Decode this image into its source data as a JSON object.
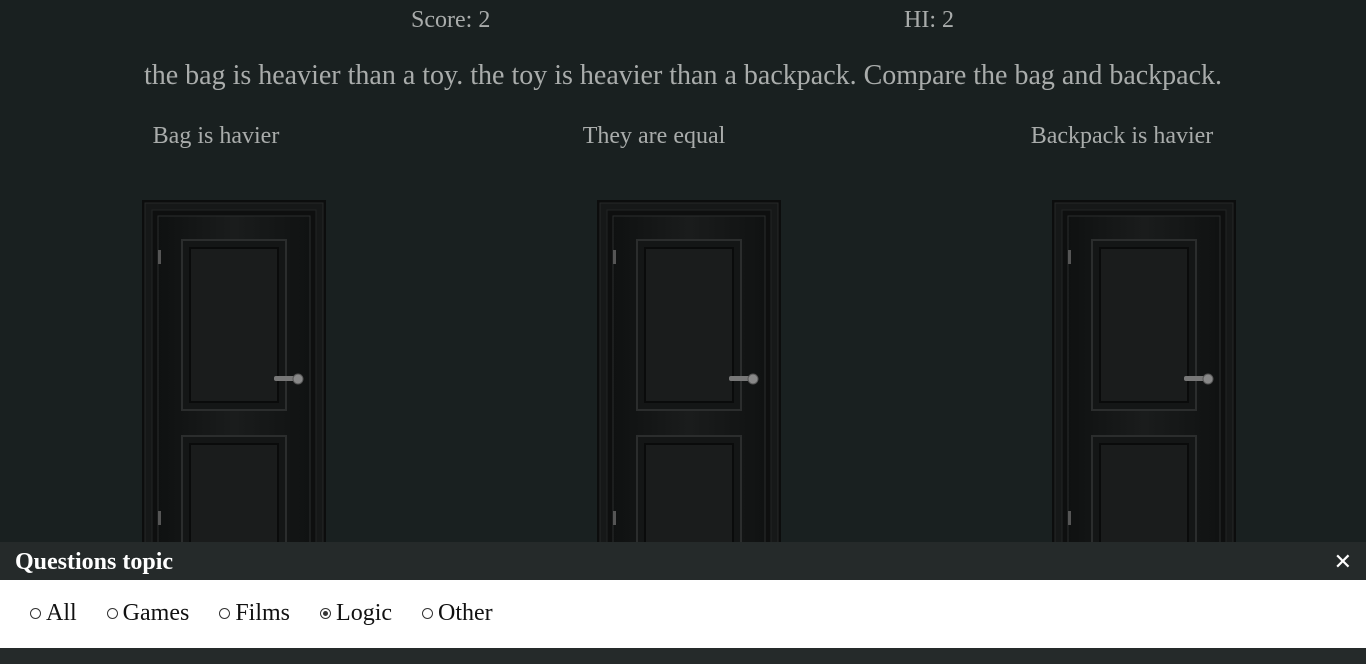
{
  "header": {
    "score": "Score: 2",
    "high_score": "HI: 2"
  },
  "question": "the bag is heavier than a toy. the toy is heavier than a backpack. Compare the bag and backpack.",
  "options": [
    {
      "label": "Bag is havier"
    },
    {
      "label": "They are equal"
    },
    {
      "label": "Backpack is havier"
    }
  ],
  "topic_panel": {
    "title": "Questions topic",
    "close_icon": "close-icon",
    "close_glyph": "✕",
    "topics": [
      {
        "label": "All",
        "selected": false
      },
      {
        "label": "Games",
        "selected": false
      },
      {
        "label": "Films",
        "selected": false
      },
      {
        "label": "Logic",
        "selected": true
      },
      {
        "label": "Other",
        "selected": false
      }
    ]
  },
  "colors": {
    "background": "#192020",
    "text": "#a9acab",
    "panel": "#252a2a"
  }
}
